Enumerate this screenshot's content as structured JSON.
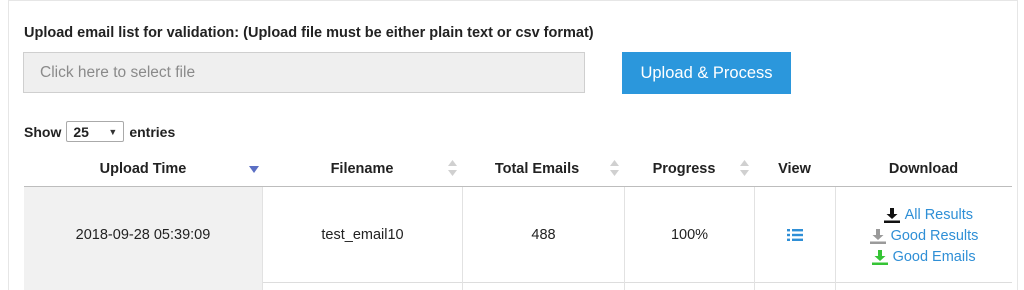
{
  "upload": {
    "heading": "Upload email list for validation: (Upload file must be either plain text or csv format)",
    "file_placeholder": "Click here to select file",
    "button_label": "Upload & Process"
  },
  "entries": {
    "show_label": "Show",
    "selected": "25",
    "suffix_label": "entries"
  },
  "table": {
    "columns": [
      {
        "label": "Upload Time",
        "sort": "descending-active"
      },
      {
        "label": "Filename",
        "sort": "sortable"
      },
      {
        "label": "Total Emails",
        "sort": "sortable"
      },
      {
        "label": "Progress",
        "sort": "sortable"
      },
      {
        "label": "View",
        "sort": "none"
      },
      {
        "label": "Download",
        "sort": "none"
      }
    ],
    "rows": [
      {
        "upload_time": "2018-09-28 05:39:09",
        "filename": "test_email10",
        "total_emails": "488",
        "progress": "100%",
        "view_icon": "list-icon",
        "downloads": [
          {
            "label": "All Results",
            "icon": "download-icon",
            "icon_color": "#111111"
          },
          {
            "label": "Good Results",
            "icon": "download-icon",
            "icon_color": "#9a9a9a"
          },
          {
            "label": "Good Emails",
            "icon": "download-icon",
            "icon_color": "#35c435"
          }
        ]
      }
    ]
  },
  "colors": {
    "accent": "#2b97dc",
    "link": "#2f8fd6",
    "sort_active": "#5b6fc4",
    "sort_inactive": "#d0d0d0"
  }
}
